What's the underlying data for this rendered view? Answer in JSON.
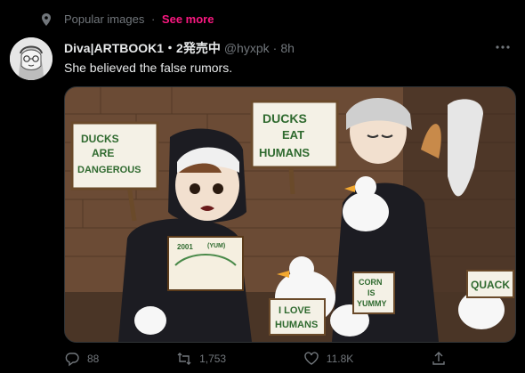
{
  "context": {
    "icon": "location-pin-icon",
    "label": "Popular images",
    "separator": "·",
    "see_more": "See more"
  },
  "tweet": {
    "display_name": "Diva|ARTBOOK1・2発売中",
    "handle": "@hyxpk",
    "dot": "·",
    "time": "8h",
    "more_icon": "more-horizontal-icon",
    "text": "She believed the false rumors."
  },
  "image": {
    "sign_left": [
      "DUCKS",
      "ARE",
      "DANGEROUS"
    ],
    "sign_center": [
      "DUCKS",
      "EAT",
      "HUMANS"
    ],
    "sign_board_small_title": "2001",
    "sign_board_small_sub": "(YUM)",
    "sign_corn": [
      "CORN",
      "IS",
      "YUMMY"
    ],
    "sign_love": [
      "I LOVE",
      "HUMANS"
    ],
    "sign_quack": "QUACK"
  },
  "actions": {
    "reply_count": "88",
    "retweet_count": "1,753",
    "like_count": "11.8K",
    "reply_icon": "reply-icon",
    "retweet_icon": "retweet-icon",
    "like_icon": "heart-icon",
    "share_icon": "share-icon"
  }
}
